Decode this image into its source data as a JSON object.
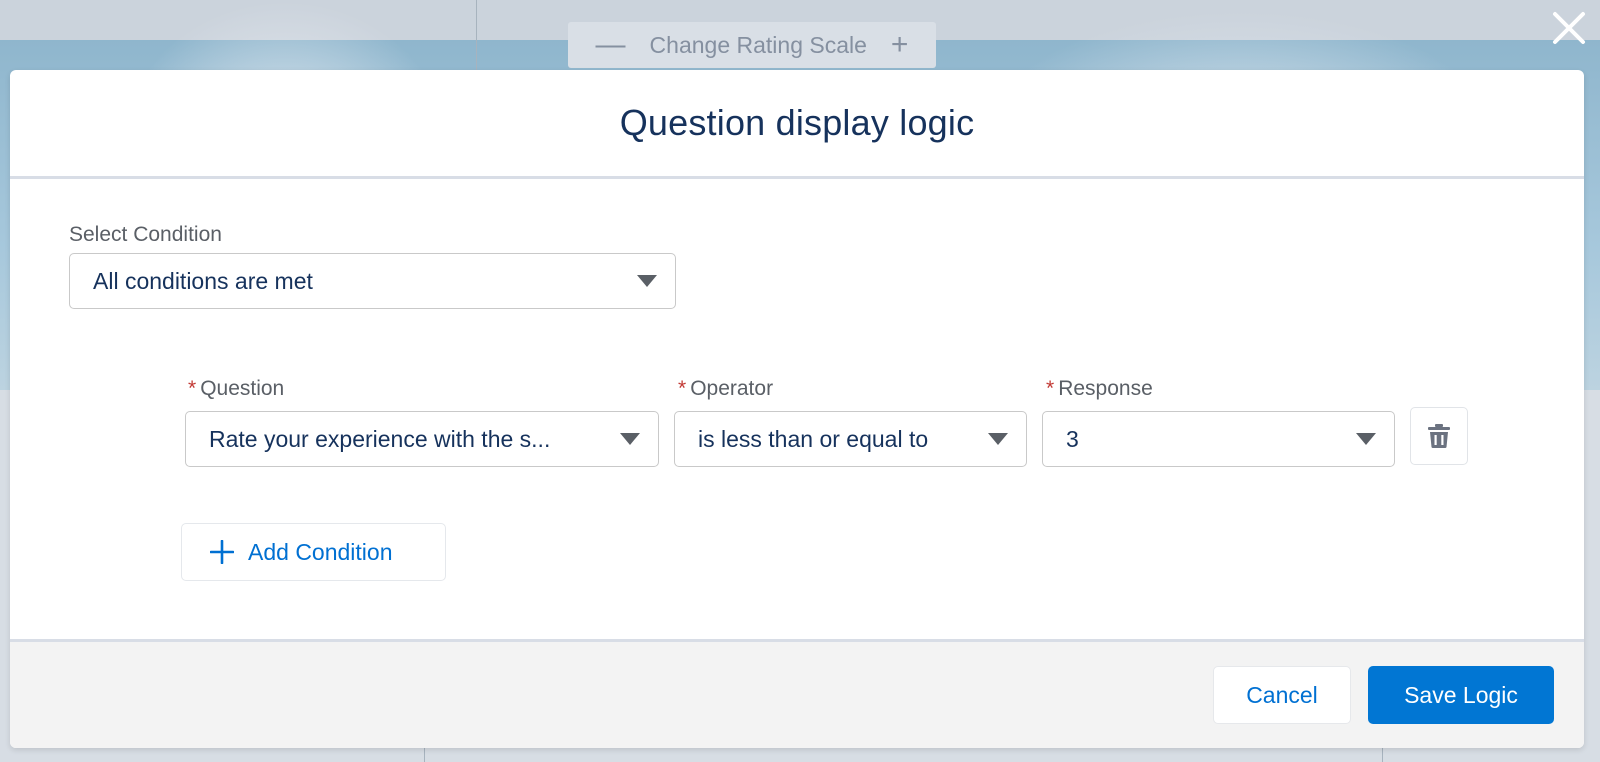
{
  "background": {
    "toolbar": {
      "minus_glyph": "—",
      "label": "Change Rating Scale",
      "plus_glyph": "+"
    }
  },
  "modal": {
    "title": "Question display logic",
    "close_icon": "close-icon",
    "select_condition": {
      "label": "Select Condition",
      "value": "All conditions are met"
    },
    "condition": {
      "required_mark": "*",
      "question": {
        "label": "Question",
        "value": "Rate your experience with the s..."
      },
      "operator": {
        "label": "Operator",
        "value": "is less than or equal to"
      },
      "response": {
        "label": "Response",
        "value": "3"
      },
      "delete_icon": "trash-icon"
    },
    "add_condition": {
      "icon": "plus-icon",
      "label": "Add Condition"
    },
    "footer": {
      "cancel_label": "Cancel",
      "save_label": "Save Logic"
    }
  },
  "colors": {
    "title_text": "#16325c",
    "link_blue": "#0070d2",
    "brand_button": "#0176d3",
    "required_red": "#c23934"
  }
}
